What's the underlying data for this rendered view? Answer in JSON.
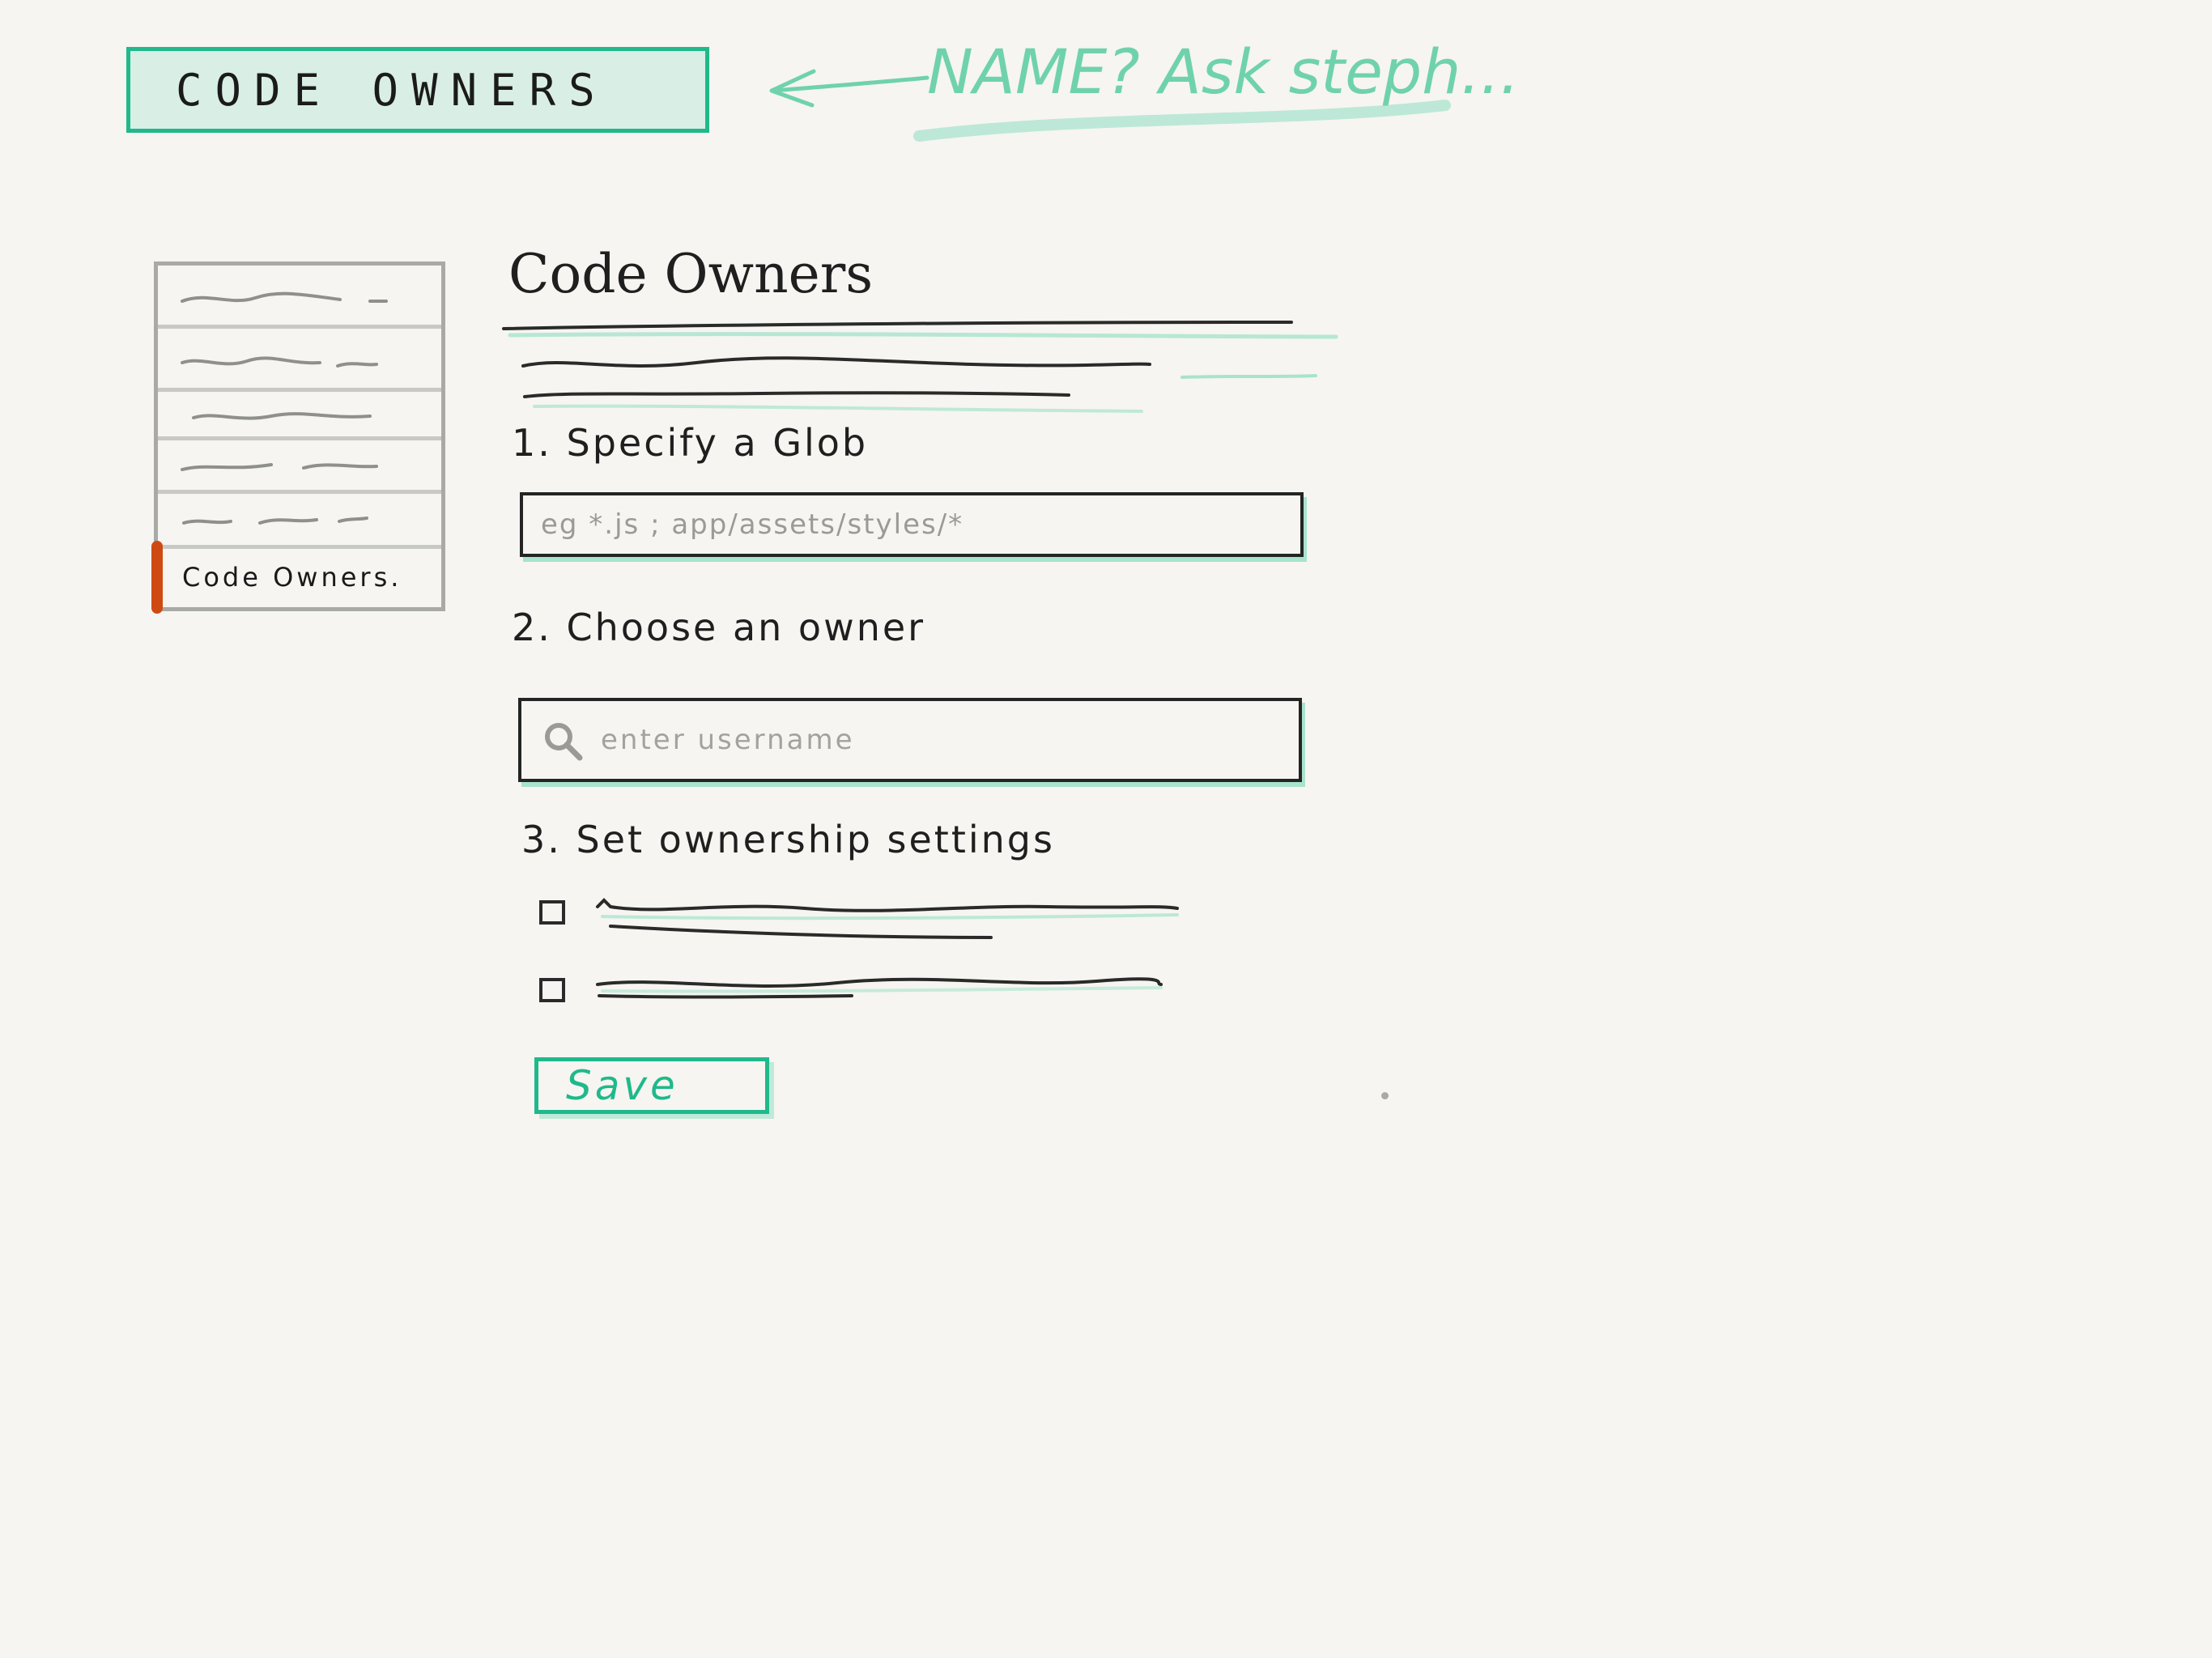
{
  "banner": {
    "title": "CODE OWNERS"
  },
  "annotation": {
    "note": "NAME? Ask steph..."
  },
  "sidebar": {
    "active_item_label": "Code Owners."
  },
  "main": {
    "page_title": "Code Owners",
    "steps": {
      "step1_label": "1. Specify a Glob",
      "glob_placeholder": "eg *.js ; app/assets/styles/*",
      "step2_label": "2. Choose an owner",
      "owner_placeholder": "enter username",
      "step3_label": "3. Set ownership settings"
    },
    "save_label": "Save"
  },
  "colors": {
    "accent": "#1fb98b",
    "accent_light": "#d9efe6",
    "active_marker": "#cf4a12",
    "background": "#f6f5f1"
  },
  "icons": {
    "arrow": "arrow-left-icon",
    "search": "search-icon"
  }
}
